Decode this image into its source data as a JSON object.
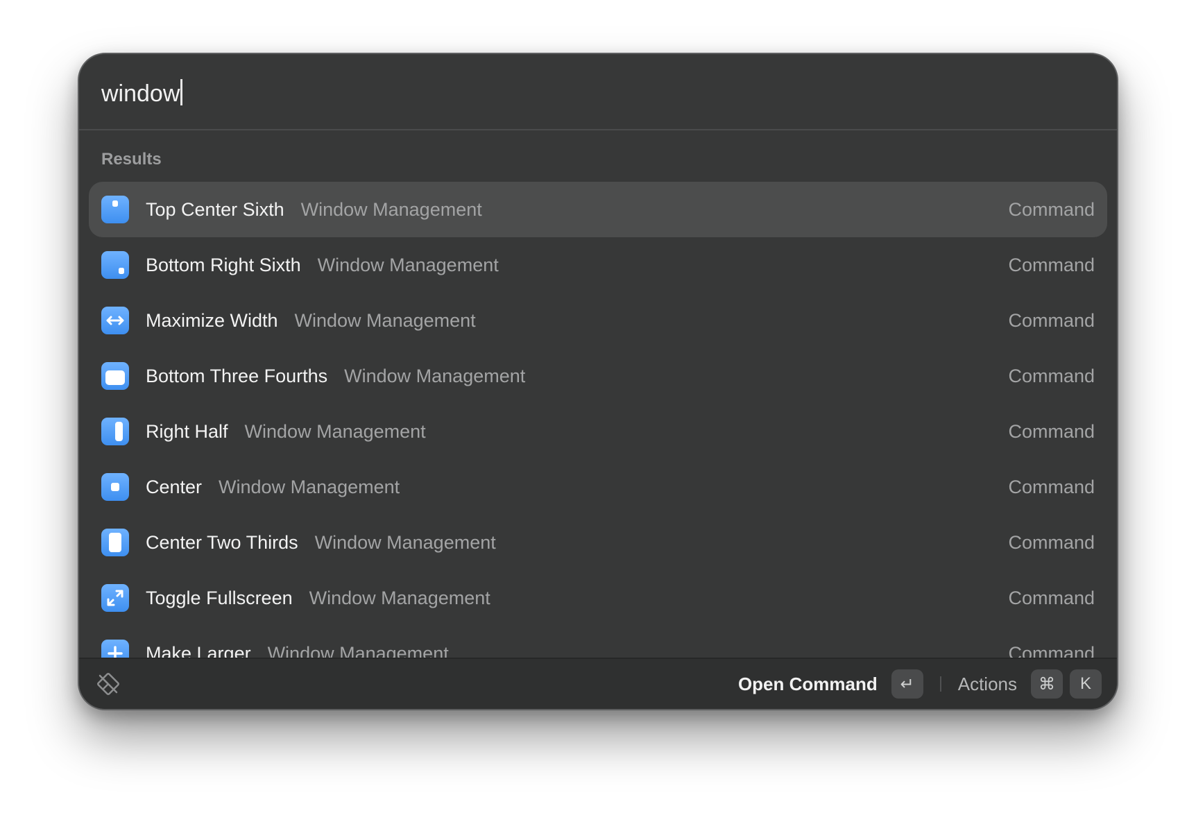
{
  "search": {
    "query": "window"
  },
  "results": {
    "section_title": "Results",
    "items": [
      {
        "title": "Top Center Sixth",
        "subtitle": "Window Management",
        "kind": "Command",
        "icon": "top-center-sixth-icon",
        "selected": true
      },
      {
        "title": "Bottom Right Sixth",
        "subtitle": "Window Management",
        "kind": "Command",
        "icon": "bottom-right-sixth-icon"
      },
      {
        "title": "Maximize Width",
        "subtitle": "Window Management",
        "kind": "Command",
        "icon": "maximize-width-icon"
      },
      {
        "title": "Bottom Three Fourths",
        "subtitle": "Window Management",
        "kind": "Command",
        "icon": "bottom-three-fourths-icon"
      },
      {
        "title": "Right Half",
        "subtitle": "Window Management",
        "kind": "Command",
        "icon": "right-half-icon"
      },
      {
        "title": "Center",
        "subtitle": "Window Management",
        "kind": "Command",
        "icon": "center-icon"
      },
      {
        "title": "Center Two Thirds",
        "subtitle": "Window Management",
        "kind": "Command",
        "icon": "center-two-thirds-icon"
      },
      {
        "title": "Toggle Fullscreen",
        "subtitle": "Window Management",
        "kind": "Command",
        "icon": "toggle-fullscreen-icon"
      },
      {
        "title": "Make Larger",
        "subtitle": "Window Management",
        "kind": "Command",
        "icon": "make-larger-icon"
      }
    ]
  },
  "footer": {
    "logo_icon": "raycast-logo-icon",
    "primary_action": "Open Command",
    "primary_key": "↵",
    "secondary_action": "Actions",
    "secondary_keys": [
      "⌘",
      "K"
    ]
  },
  "colors": {
    "background": "#373838",
    "selected_row": "#4c4d4d",
    "icon_blue": "#4a96f5",
    "footer": "#2f3030"
  }
}
